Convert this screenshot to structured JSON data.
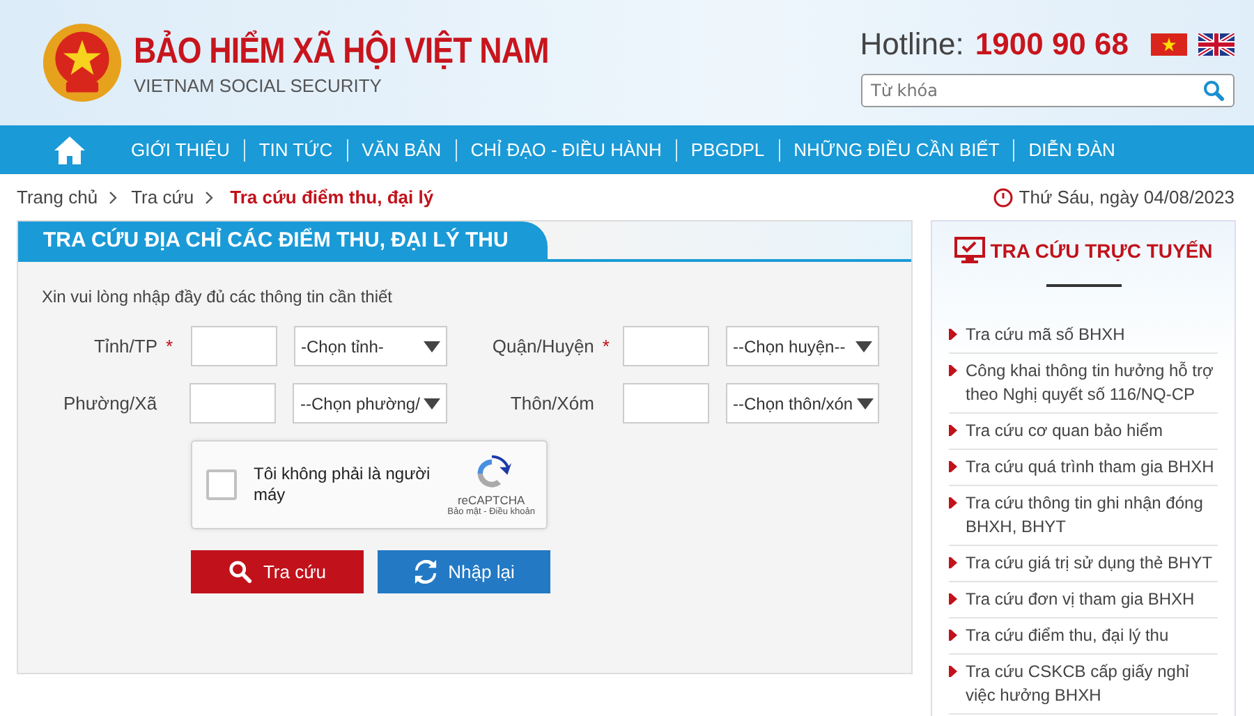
{
  "header": {
    "title": "BẢO HIỂM XÃ HỘI VIỆT NAM",
    "subtitle": "VIETNAM SOCIAL SECURITY",
    "hotline_label": "Hotline:",
    "hotline_number": "1900 90 68",
    "search": {
      "placeholder": "Từ khóa"
    }
  },
  "nav": [
    "GIỚI THIỆU",
    "TIN TỨC",
    "VĂN BẢN",
    "CHỈ ĐẠO - ĐIỀU HÀNH",
    "PBGDPL",
    "NHỮNG ĐIỀU CẦN BIẾT",
    "DIỄN ĐÀN"
  ],
  "breadcrumb": [
    {
      "label": "Trang chủ",
      "current": false
    },
    {
      "label": "Tra cứu",
      "current": false
    },
    {
      "label": "Tra cứu điểm thu, đại lý",
      "current": true
    }
  ],
  "date": "Thứ Sáu, ngày 04/08/2023",
  "panel": {
    "title": "TRA CỨU ĐỊA CHỈ CÁC ĐIỂM THU, ĐẠI LÝ THU",
    "intro": "Xin vui lòng nhập đầy đủ các thông tin cần thiết",
    "required_mark": "*",
    "fields": [
      {
        "label": "Tỉnh/TP",
        "required": true,
        "select": "-Chọn tỉnh-"
      },
      {
        "label": "Quận/Huyện",
        "required": true,
        "select": "--Chọn huyện--"
      },
      {
        "label": "Phường/Xã",
        "required": false,
        "select": "--Chọn phường/"
      },
      {
        "label": "Thôn/Xóm",
        "required": false,
        "select": "--Chọn thôn/xón"
      }
    ],
    "captcha": {
      "checked": false,
      "label": "Tôi không phải là người máy",
      "brand": "reCAPTCHA",
      "links": "Bảo mật - Điều khoản"
    },
    "buttons": [
      {
        "label": "Tra cứu",
        "kind": "search"
      },
      {
        "label": "Nhập lại",
        "kind": "reset"
      }
    ]
  },
  "sidebar": {
    "title": "TRA CỨU TRỰC TUYẾN",
    "links": [
      "Tra cứu mã số BHXH",
      "Công khai thông tin hưởng hỗ trợ theo Nghị quyết số 116/NQ-CP",
      "Tra cứu cơ quan bảo hiểm",
      "Tra cứu quá trình tham gia BHXH",
      "Tra cứu thông tin ghi nhận đóng BHXH, BHYT",
      "Tra cứu giá trị sử dụng thẻ BHYT",
      "Tra cứu đơn vị tham gia BHXH",
      "Tra cứu điểm thu, đại lý thu",
      "Tra cứu CSKCB cấp giấy nghỉ việc hưởng BHXH"
    ]
  }
}
